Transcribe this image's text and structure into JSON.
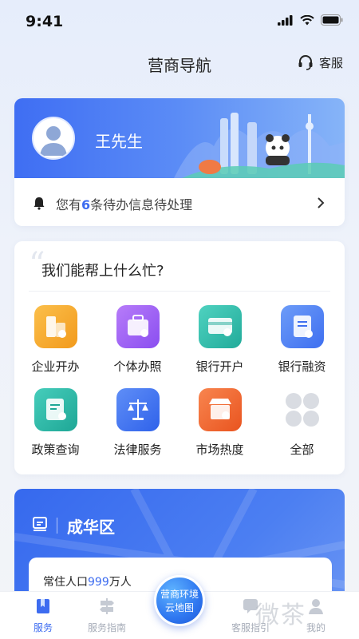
{
  "status_bar": {
    "time": "9:41"
  },
  "header": {
    "title": "营商导航",
    "service_label": "客服"
  },
  "user": {
    "name": "王先生"
  },
  "notice": {
    "prefix": "您有",
    "count": "6",
    "suffix": "条待办信息待处理"
  },
  "help": {
    "title": "我们能帮上什么忙?",
    "items": [
      {
        "label": "企业开办",
        "icon": "building-icon",
        "color": "#f5a623"
      },
      {
        "label": "个体办照",
        "icon": "briefcase-icon",
        "color": "#9b59f5"
      },
      {
        "label": "银行开户",
        "icon": "bank-card-icon",
        "color": "#2bbfae"
      },
      {
        "label": "银行融资",
        "icon": "finance-doc-icon",
        "color": "#4d7ff4"
      },
      {
        "label": "政策查询",
        "icon": "policy-doc-icon",
        "color": "#26b8a8"
      },
      {
        "label": "法律服务",
        "icon": "scale-icon",
        "color": "#3d74f0"
      },
      {
        "label": "市场热度",
        "icon": "store-icon",
        "color": "#f06a38"
      },
      {
        "label": "全部",
        "icon": "grid-all-icon",
        "color": "#d9dce2"
      }
    ]
  },
  "district": {
    "name": "成华区",
    "population_prefix": "常住人口",
    "population_value": "999",
    "population_unit": "万人"
  },
  "fab": {
    "line1": "营商环境",
    "line2": "云地图"
  },
  "tabs": [
    {
      "label": "服务",
      "icon": "service-icon",
      "active": true
    },
    {
      "label": "服务指南",
      "icon": "guide-sign-icon",
      "active": false
    },
    {
      "label": "客服指引",
      "icon": "chat-icon",
      "active": false
    },
    {
      "label": "我的",
      "icon": "profile-icon",
      "active": false
    }
  ],
  "watermark": "微茶"
}
